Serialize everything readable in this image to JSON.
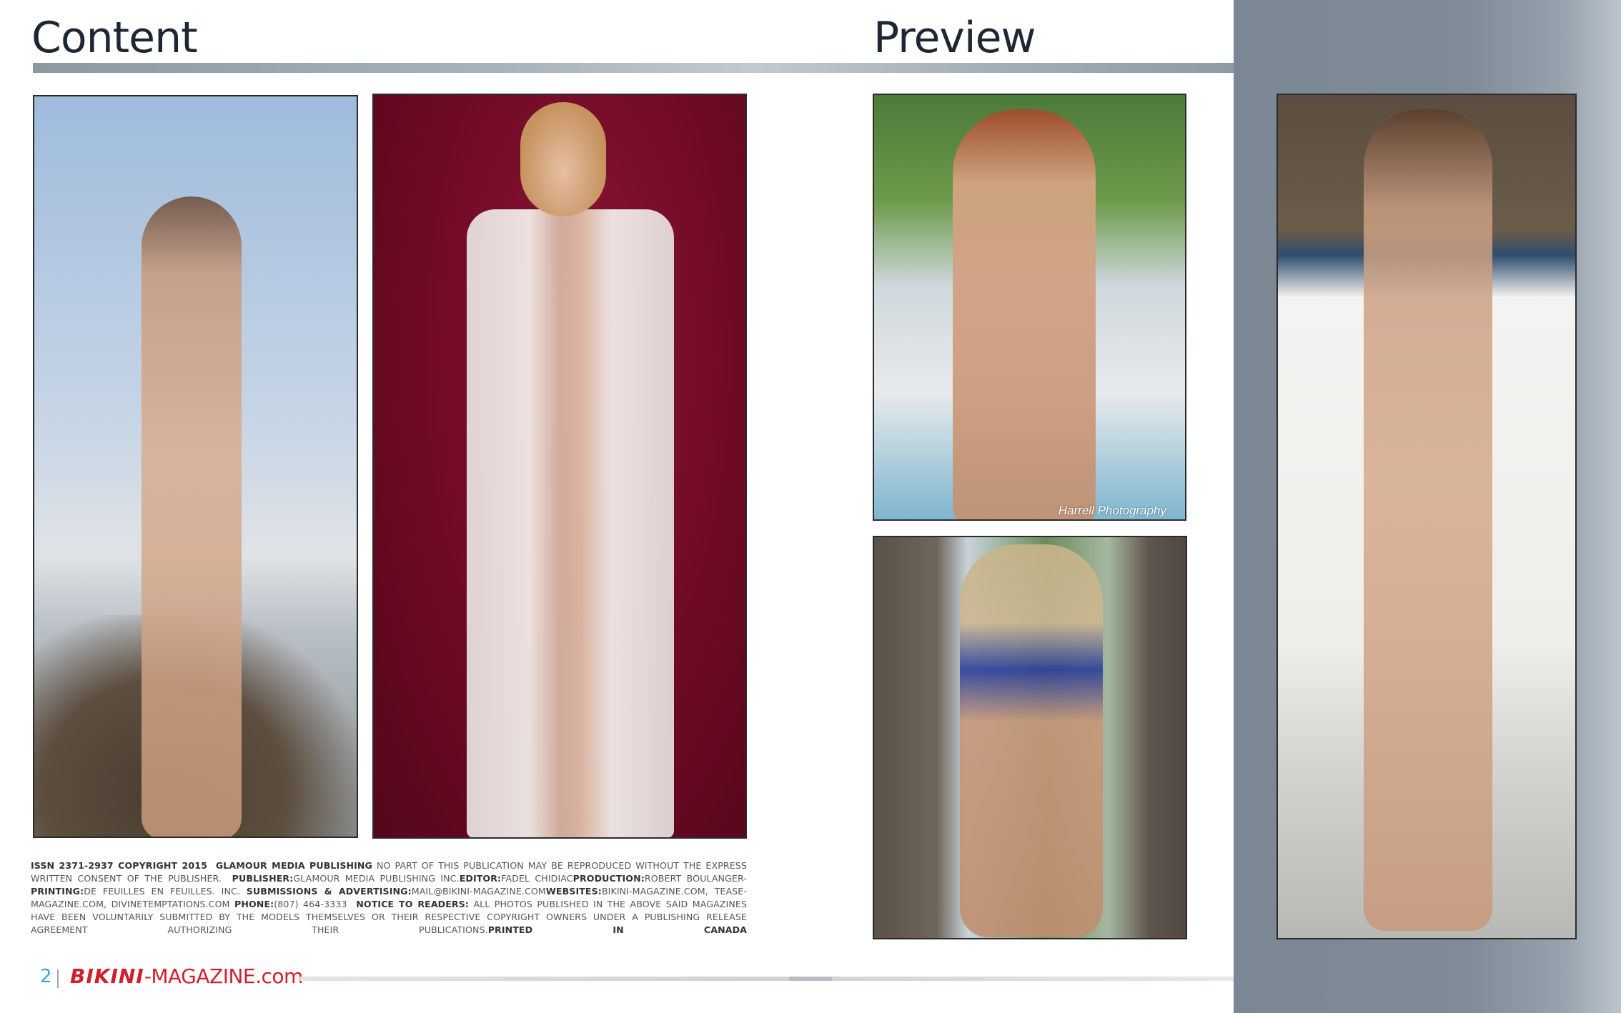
{
  "header": {
    "left_title": "Content",
    "right_title": "Preview"
  },
  "photos": {
    "credit_text": "Harrell Photography"
  },
  "legal": {
    "issn": "ISSN 2371-2937 COPYRIGHT 2015",
    "company": "GLAMOUR MEDIA PUBLISHING",
    "notice_part": "NO PART OF THIS PUBLICATION MAY BE REPRODUCED WITHOUT THE EXPRESS WRITTEN CONSENT OF THE PUBLISHER.",
    "publisher_label": "PUBLISHER:",
    "publisher_value": "GLAMOUR MEDIA PUBLISHING INC.",
    "editor_label": "EDITOR:",
    "editor_value": "FADEL CHIDIAC",
    "production_label": "PRODUCTION:",
    "production_value": "ROBERT BOULANGER-",
    "printing_label": "PRINTING:",
    "printing_value": "DE FEUILLES EN FEUILLES. INC.",
    "submissions_label": "SUBMISSIONS & ADVERTISING:",
    "submissions_value": "MAIL@BIKINI-MAGAZINE.COM",
    "websites_label": "WEBSITES:",
    "websites_value": "BIKINI-MAGAZINE.COM, TEASE-MAGAZINE.COM, DIVINETEMPTATIONS.COM",
    "phone_label": "PHONE:",
    "phone_value": "(807) 464-3333",
    "readers_label": "NOTICE TO READERS:",
    "readers_value": "ALL PHOTOS PUBLISHED IN THE ABOVE SAID MAGAZINES HAVE BEEN VOLUNTARILY SUBMITTED BY THE MODELS THEMSELVES OR THEIR RESPECTIVE COPYRIGHT OWNERS UNDER A PUBLISHING RELEASE AGREEMENT AUTHORIZING THEIR PUBLICATIONS.",
    "printed_label": "PRINTED IN CANADA"
  },
  "footer": {
    "page_number": "2",
    "logo_brand": "BIKINI",
    "logo_rest": "-MAGAZINE.com"
  },
  "colors": {
    "accent_red": "#d11f2c",
    "page_number_blue": "#3aa7d6",
    "side_panel": "#7f8b97"
  }
}
